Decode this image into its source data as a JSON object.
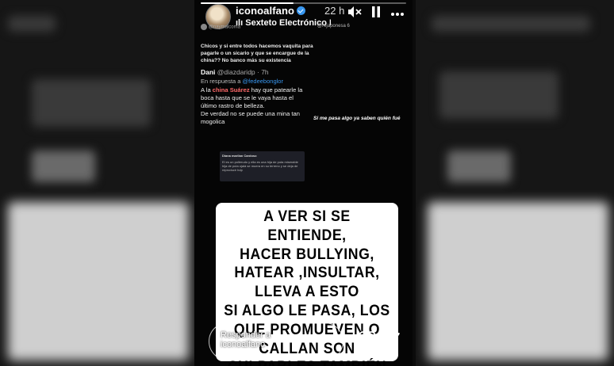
{
  "story": {
    "username": "iconoalfano",
    "time_ago": "22 h",
    "music": "Sexteto Electrónico N",
    "progress": 0.45
  },
  "screenshot": {
    "post_handle": "@naymalcoma",
    "post_text": "Chicos y si entre todos hacemos vaquita para pagarle o un sicario y que se encargue de la china?? No banco más su existencia",
    "tweet_name": "Dani",
    "tweet_handle": "@diazdaridp · 7h",
    "tweet_reply_prefix": "En respuesta a",
    "tweet_reply_to": "@fedeebonglor",
    "tweet_body_1": "A la ",
    "tweet_body_bold": "china Suárez",
    "tweet_body_2": " hay que patearle la boca hasta que se le vaya hasta el último rastro de belleza.",
    "tweet_body_3": "De verdad no se puede una mina tan mogolica",
    "quote_name": "Diana marilan Cardoso",
    "quote_text": "El es un pollerudo y ella es una hija de puta miserable hija de puta ojalá se muera en su terreno y se deja de reproducir hdp",
    "side_text": "Si me pasa algo ya saben quién fué",
    "top_tag": "@rejaponesa 6"
  },
  "caption_lines": [
    "A VER SI SE ENTIENDE,",
    "HACER BULLYING,",
    "HATEAR ,INSULTAR,",
    "LLEVA A ESTO",
    "SI ALGO LE PASA, LOS",
    "QUE PROMUEVEN O",
    "CALLAN SON",
    "CULPABLES TAMBIÉN"
  ],
  "reply": {
    "placeholder_1": "Responder a",
    "placeholder_2": "iconoalfano"
  },
  "icons": {
    "mute": "speaker-muted-icon",
    "pause": "pause-icon",
    "more": "more-icon",
    "heart": "heart-icon",
    "send": "send-icon"
  }
}
